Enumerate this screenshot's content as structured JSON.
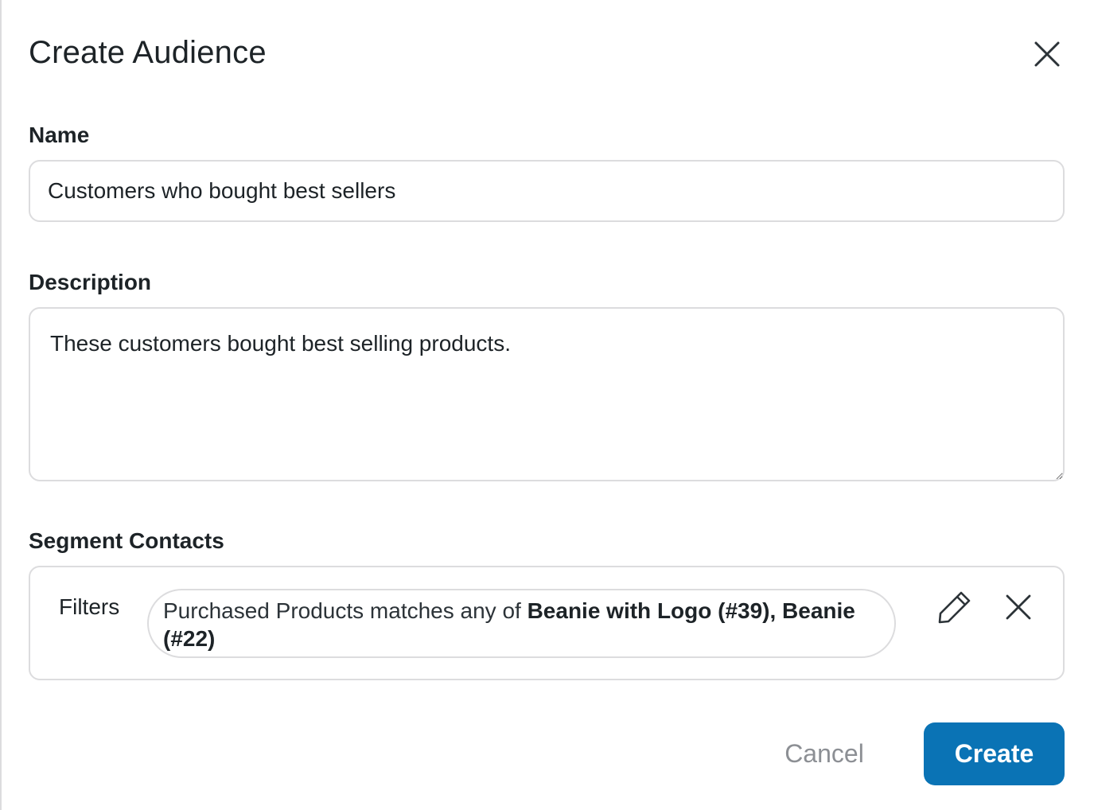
{
  "dialog": {
    "title": "Create Audience",
    "close_icon": "close-icon"
  },
  "name_field": {
    "label": "Name",
    "value": "Customers who bought best sellers"
  },
  "description_field": {
    "label": "Description",
    "value": "These customers bought best selling products."
  },
  "segment": {
    "label": "Segment Contacts",
    "filters_label": "Filters",
    "filter": {
      "prefix": "Purchased Products matches any of ",
      "values": "Beanie with Logo (#39), Beanie (#22)"
    },
    "edit_icon": "pencil-icon",
    "remove_icon": "close-icon"
  },
  "actions": {
    "cancel_label": "Cancel",
    "create_label": "Create",
    "create_color": "#0a73b5"
  }
}
